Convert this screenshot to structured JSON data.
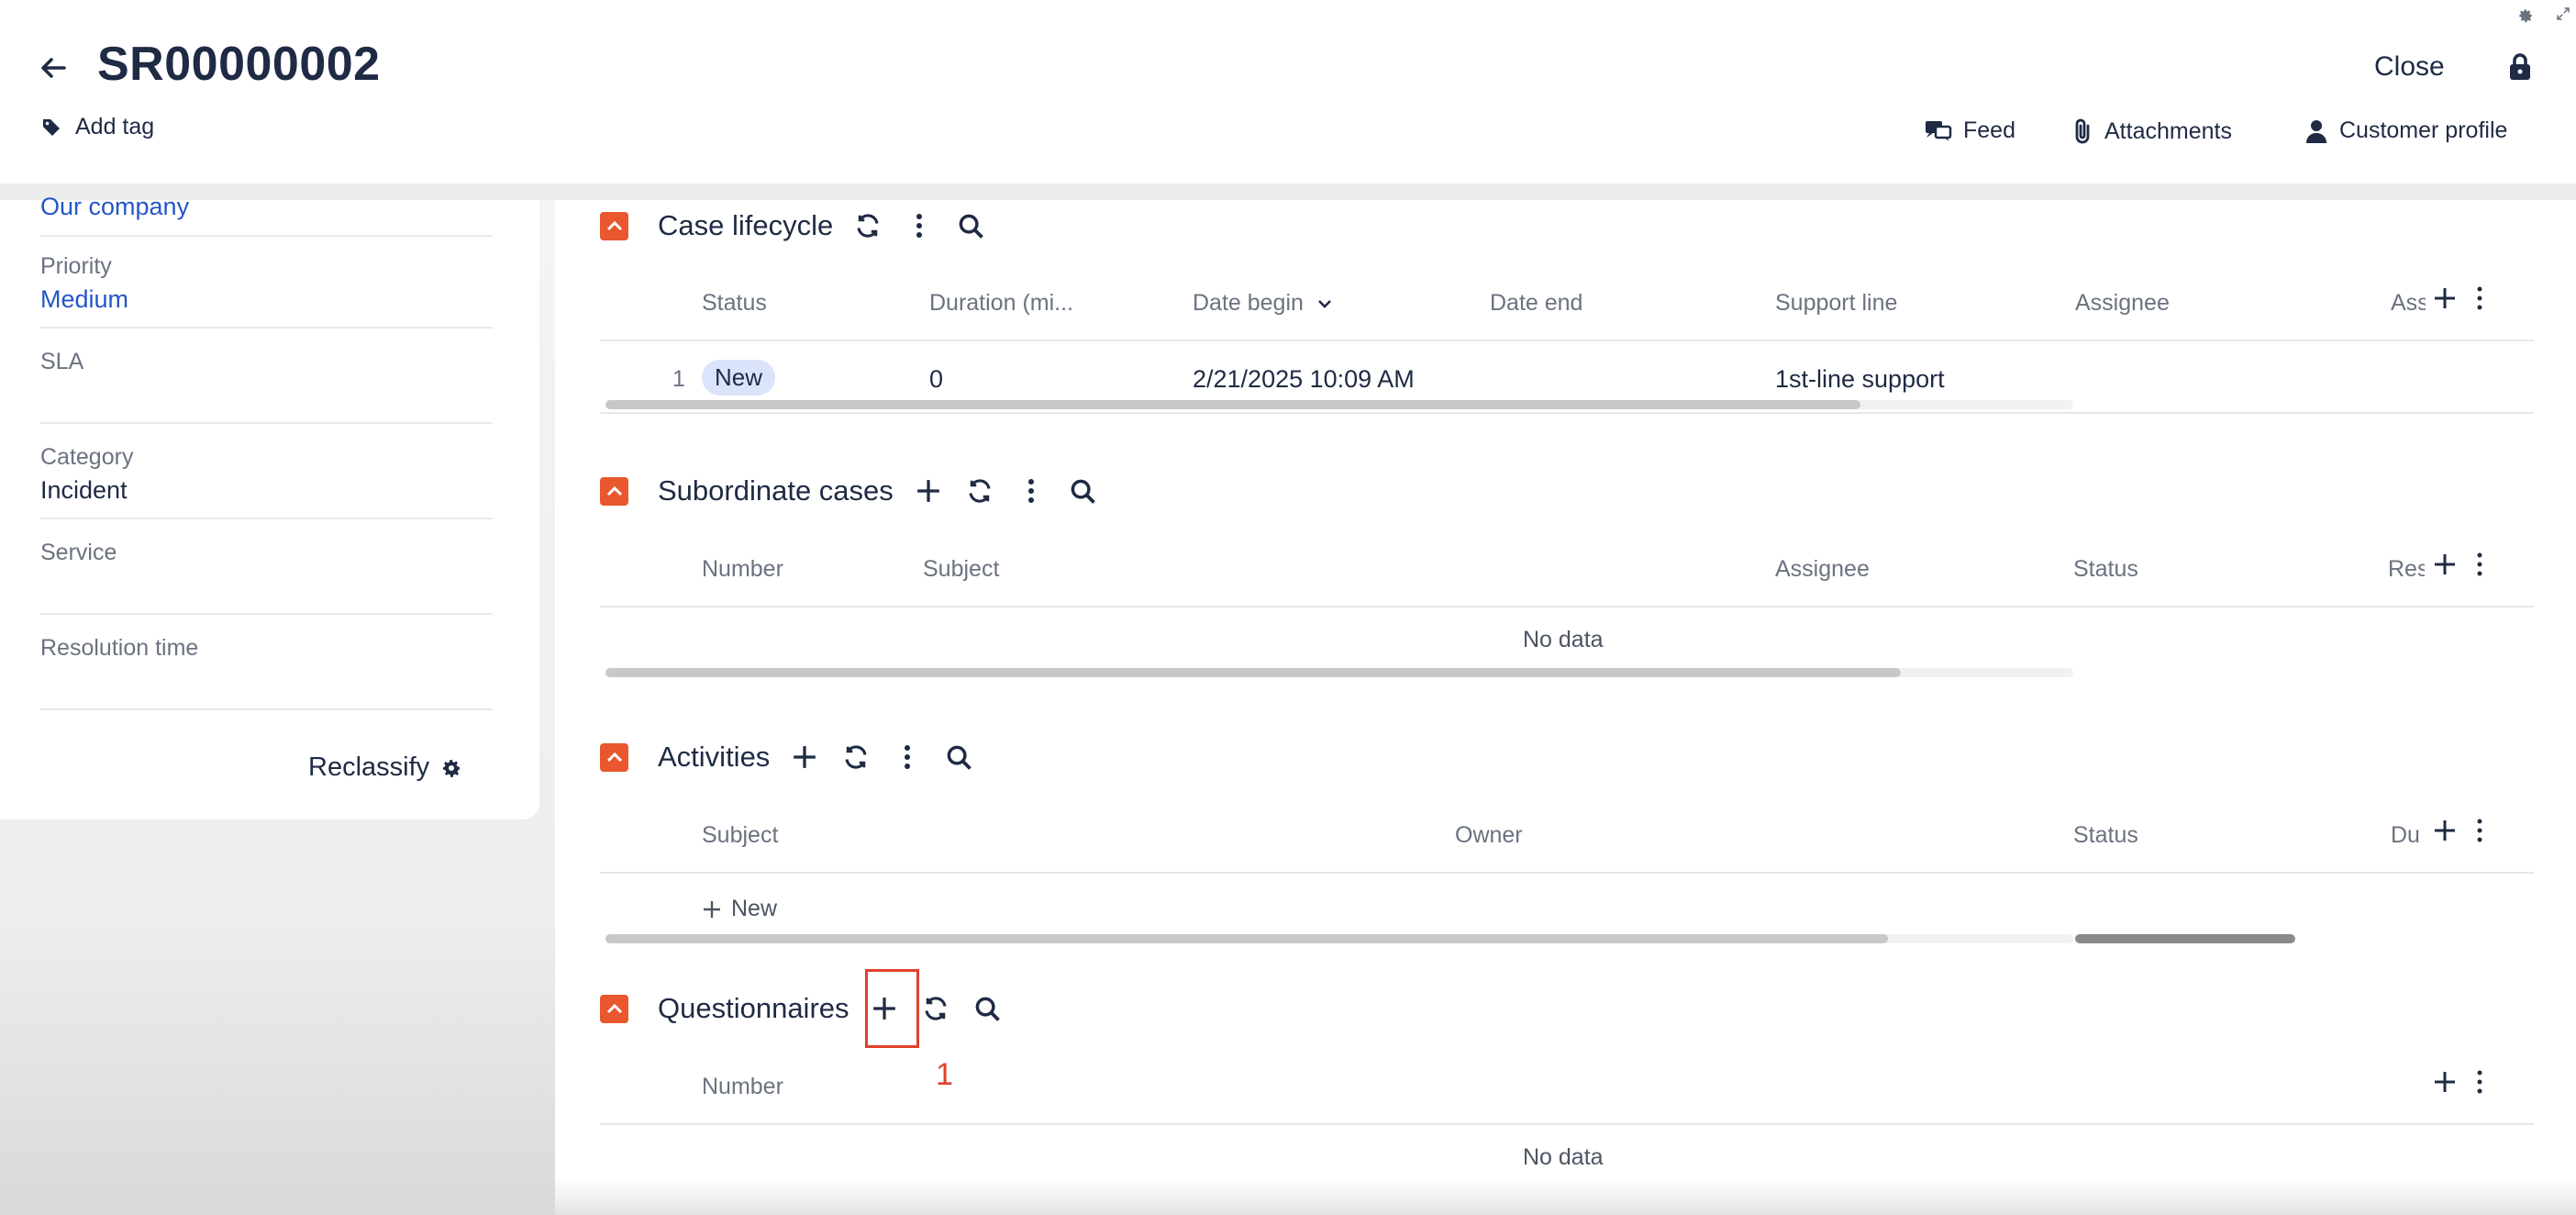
{
  "header": {
    "title": "SR00000002",
    "add_tag": "Add tag",
    "close": "Close",
    "feed": "Feed",
    "attachments": "Attachments",
    "customer_profile": "Customer profile"
  },
  "left_panel": {
    "company": "Our company",
    "fields": [
      {
        "label": "Priority",
        "value": "Medium"
      },
      {
        "label": "SLA",
        "value": ""
      },
      {
        "label": "Category",
        "value": "Incident"
      },
      {
        "label": "Service",
        "value": ""
      },
      {
        "label": "Resolution time",
        "value": ""
      }
    ],
    "reclassify": "Reclassify"
  },
  "case_lifecycle": {
    "title": "Case lifecycle",
    "columns": [
      "Status",
      "Duration (mi...",
      "Date begin",
      "Date end",
      "Support line",
      "Assignee",
      "Ass"
    ],
    "rows": [
      {
        "num": "1",
        "status": "New",
        "duration": "0",
        "date_begin": "2/21/2025 10:09 AM",
        "date_end": "",
        "support_line": "1st-line support",
        "assignee": ""
      }
    ]
  },
  "subordinate_cases": {
    "title": "Subordinate cases",
    "columns": [
      "Number",
      "Subject",
      "Assignee",
      "Status",
      "Res"
    ],
    "empty": "No data"
  },
  "activities": {
    "title": "Activities",
    "columns": [
      "Subject",
      "Owner",
      "Status",
      "Du"
    ],
    "new_label": "New"
  },
  "questionnaires": {
    "title": "Questionnaires",
    "columns": [
      "Number"
    ],
    "empty": "No data"
  },
  "annotation": {
    "label": "1",
    "color": "#e0402b"
  },
  "colors": {
    "accent": "#e8572d",
    "text": "#1f2a44",
    "link": "#2456c9",
    "badge_bg": "#dbe4fa"
  }
}
